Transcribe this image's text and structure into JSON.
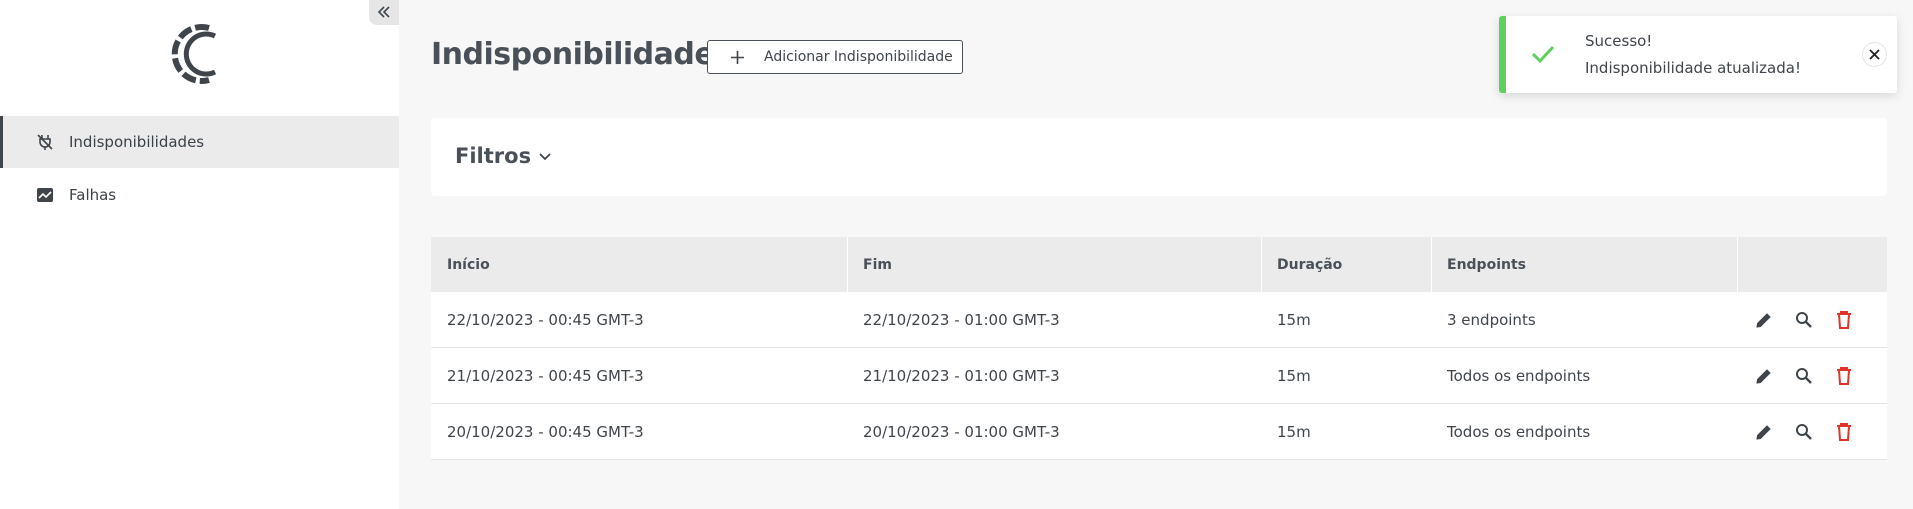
{
  "sidebar": {
    "items": [
      {
        "label": "Indisponibilidades",
        "icon": "plug-off-icon",
        "active": true
      },
      {
        "label": "Falhas",
        "icon": "chart-image-icon",
        "active": false
      }
    ]
  },
  "header": {
    "title": "Indisponibilidades",
    "add_button_label": "Adicionar Indisponibilidade"
  },
  "filters": {
    "title": "Filtros"
  },
  "table": {
    "columns": [
      "Início",
      "Fim",
      "Duração",
      "Endpoints"
    ],
    "rows": [
      {
        "inicio": "22/10/2023 - 00:45 GMT-3",
        "fim": "22/10/2023 - 01:00 GMT-3",
        "duracao": "15m",
        "endpoints": "3 endpoints"
      },
      {
        "inicio": "21/10/2023 - 00:45 GMT-3",
        "fim": "21/10/2023 - 01:00 GMT-3",
        "duracao": "15m",
        "endpoints": "Todos os endpoints"
      },
      {
        "inicio": "20/10/2023 - 00:45 GMT-3",
        "fim": "20/10/2023 - 01:00 GMT-3",
        "duracao": "15m",
        "endpoints": "Todos os endpoints"
      }
    ]
  },
  "toast": {
    "title": "Sucesso!",
    "message": "Indisponibilidade atualizada!"
  },
  "colors": {
    "accent": "#4a5058",
    "success": "#5fcf5f",
    "danger": "#e0342a"
  }
}
